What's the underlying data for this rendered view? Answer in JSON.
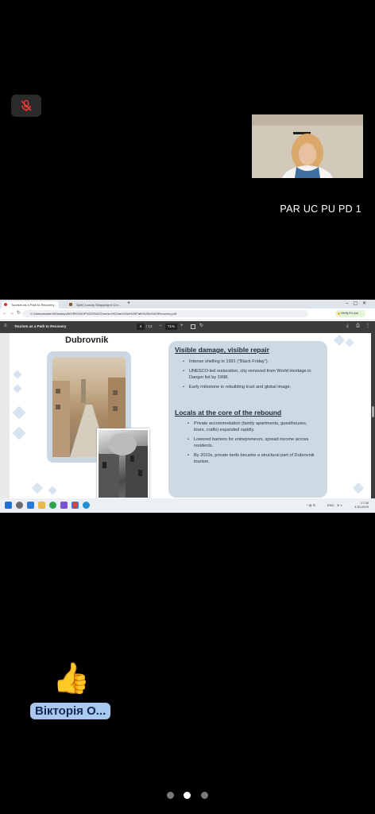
{
  "participant": {
    "name": "PAR UC PU PD 1"
  },
  "browser": {
    "tabs": [
      "Tourism as a Path to Recovery",
      "Split | Luxury Shopping in Cro..."
    ],
    "url": "C:/Users/student/Desktop/WORKSHOP%203%20Tourism%20as%20a%20Path%20to%20Recovery.pdf",
    "verify_label": "Verify it's you"
  },
  "pdf": {
    "doc_title": "Tourism as a Path to Recovery",
    "page_current": "4",
    "page_total": "/ 13",
    "zoom": "71%"
  },
  "slide": {
    "title": "Dubrovnik",
    "section1": {
      "heading": "Visible damage, visible repair",
      "bullets": [
        "Intense shelling in 1991 (“Black Friday”).",
        "UNESCO-led restoration, city removed from World Heritage in Danger list by 1998.",
        "Early milestone in rebuilding trust and global image."
      ]
    },
    "section2": {
      "heading": "Locals at the core of the rebound",
      "bullets": [
        "Private accommodation (family apartments, guesthouses, tours, crafts) expanded rapidly.",
        "Lowered barriers for entrepreneurs, spread income across residents.",
        "By 2010s, private beds became a structural part of Dubrovnik tourism."
      ]
    }
  },
  "taskbar": {
    "lang": "ENG",
    "time": "17:38",
    "date": "3.30.2025"
  },
  "reaction": {
    "emoji": "👍",
    "name": "Вікторія О..."
  },
  "pager": {
    "count": 3,
    "active": 1
  }
}
